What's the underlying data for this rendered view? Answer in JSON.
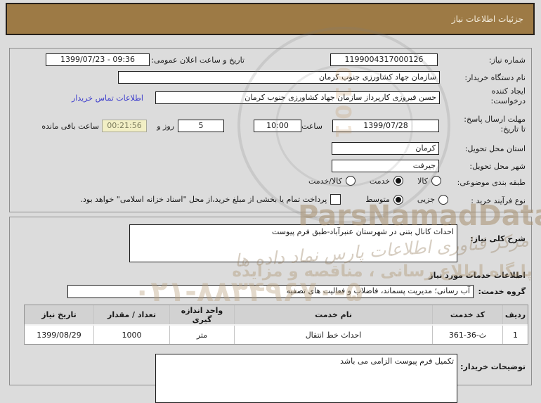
{
  "titlebar": {
    "title": "جزئیات اطلاعات نیاز"
  },
  "colors": {
    "titlebar_bg": "#9d7a45",
    "link_blue": "#3b3bcc",
    "countdown_bg": "#f2efc5",
    "table_header_bg": "#d2d2d2",
    "page_bg": "#dcdcdc"
  },
  "info": {
    "need_number": {
      "label": "شماره نیاز:",
      "value": "1199004317000126"
    },
    "announce": {
      "label": "تاریخ و ساعت اعلان عمومی:",
      "value": "1399/07/23 - 09:36"
    },
    "buyer_org": {
      "label": "نام دستگاه خریدار:",
      "value": "سازمان جهاد کشاورزی جنوب کرمان"
    },
    "creator": {
      "label_line1": "ایجاد کننده",
      "label_line2": "درخواست:",
      "value": "حسن فیروزی کارپرداز سازمان جهاد کشاورزی جنوب کرمان",
      "contact_link": "اطلاعات تماس خریدار"
    },
    "deadline": {
      "label_line1": "مهلت ارسال پاسخ:",
      "label_line2": "تا تاریخ:",
      "date": "1399/07/28",
      "hour_label": "ساعت",
      "time": "10:00",
      "days": "5",
      "days_label": "روز و",
      "countdown": "00:21:56",
      "remaining_label": "ساعت باقی مانده"
    },
    "province": {
      "label": "استان محل تحویل:",
      "value": "کرمان"
    },
    "city": {
      "label": "شهر محل تحویل:",
      "value": "جیرفت"
    },
    "classification": {
      "label": "طبقه بندی موضوعی:",
      "options": [
        {
          "label": "کالا",
          "selected": false
        },
        {
          "label": "خدمت",
          "selected": true
        },
        {
          "label": "کالا/خدمت",
          "selected": false
        }
      ]
    },
    "process": {
      "label": "نوع فرآیند خرید :",
      "options": [
        {
          "label": "جزیی",
          "selected": false
        },
        {
          "label": "متوسط",
          "selected": true
        }
      ],
      "treasury_label": "پرداخت تمام یا بخشی از مبلغ خرید،از محل \"اسناد خزانه اسلامی\" خواهد بود.",
      "treasury_checked": false
    }
  },
  "need_description": {
    "label": "شرح کلی نیاز:",
    "value": "احداث کانال بتنی در شهرستان عنبرآباد-طبق فرم پیوست"
  },
  "services_section": {
    "heading": "اطلاعات خدمات مورد نیاز",
    "group": {
      "label": "گروه خدمت:",
      "value": "آب رسانی؛ مدیریت پسماند، فاضلاب و فعالیت های تصفیه"
    },
    "table": {
      "headers": [
        "ردیف",
        "کد خدمت",
        "نام خدمت",
        "واحد اندازه گیری",
        "تعداد / مقدار",
        "تاریخ نیاز"
      ],
      "rows": [
        {
          "radif": "1",
          "code": "ث-36-361",
          "code_display": "361-36-ث",
          "name": "احداث خط انتقال",
          "unit": "متر",
          "qty": "1000",
          "date": "1399/08/29"
        }
      ]
    }
  },
  "buyer_notes": {
    "label": "توضیحات خریدار:",
    "value": "تکمیل فرم پیوست الزامی می باشد"
  },
  "watermarks": {
    "brand": "ParsNamadData",
    "digits": "0101",
    "script_line": "مرکز فناوری اطلاعات پارس نماد داده ها",
    "info_line": "پایگاه اطلاع رسانی ، مناقصه و مزایده",
    "phone": "۰۲۱-۸۸۳۴۹۶۷۰-۵"
  }
}
